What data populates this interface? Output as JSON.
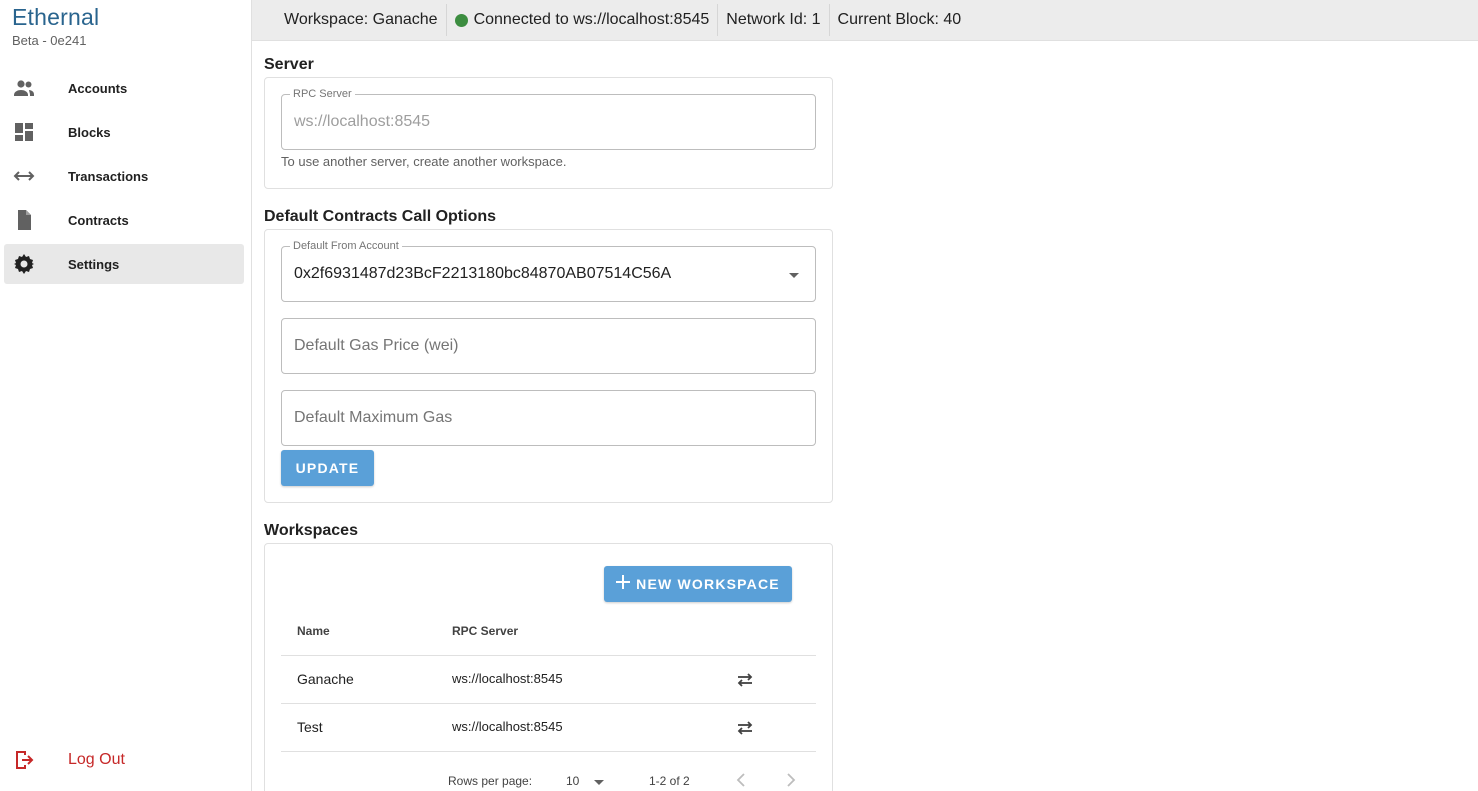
{
  "brand": {
    "title": "Ethernal",
    "subtitle": "Beta - 0e241"
  },
  "sidebar": {
    "items": [
      {
        "label": "Accounts",
        "icon": "accounts-icon"
      },
      {
        "label": "Blocks",
        "icon": "blocks-icon"
      },
      {
        "label": "Transactions",
        "icon": "transactions-icon"
      },
      {
        "label": "Contracts",
        "icon": "contracts-icon"
      },
      {
        "label": "Settings",
        "icon": "gear-icon",
        "active": true
      }
    ],
    "logout_label": "Log Out"
  },
  "topbar": {
    "workspace": "Workspace: Ganache",
    "connection": "Connected to ws://localhost:8545",
    "network": "Network Id: 1",
    "block": "Current Block: 40",
    "status_color": "#3c8d40"
  },
  "server": {
    "title": "Server",
    "rpc_legend": "RPC Server",
    "rpc_value": "ws://localhost:8545",
    "helper": "To use another server, create another workspace."
  },
  "call_options": {
    "title": "Default Contracts Call Options",
    "from_legend": "Default From Account",
    "from_value": "0x2f6931487d23BcF2213180bc84870AB07514C56A",
    "gas_price_placeholder": "Default Gas Price (wei)",
    "max_gas_placeholder": "Default Maximum Gas",
    "update_label": "UPDATE"
  },
  "workspaces": {
    "title": "Workspaces",
    "new_label": "NEW WORKSPACE",
    "columns": [
      "Name",
      "RPC Server"
    ],
    "rows": [
      {
        "name": "Ganache",
        "rpc": "ws://localhost:8545"
      },
      {
        "name": "Test",
        "rpc": "ws://localhost:8545"
      }
    ],
    "pagination": {
      "rows_per_page_label": "Rows per page:",
      "rows_per_page": "10",
      "range": "1-2 of 2"
    }
  },
  "colors": {
    "accent": "#5aa0d8",
    "brand": "#29648e",
    "logout": "#c62828"
  }
}
